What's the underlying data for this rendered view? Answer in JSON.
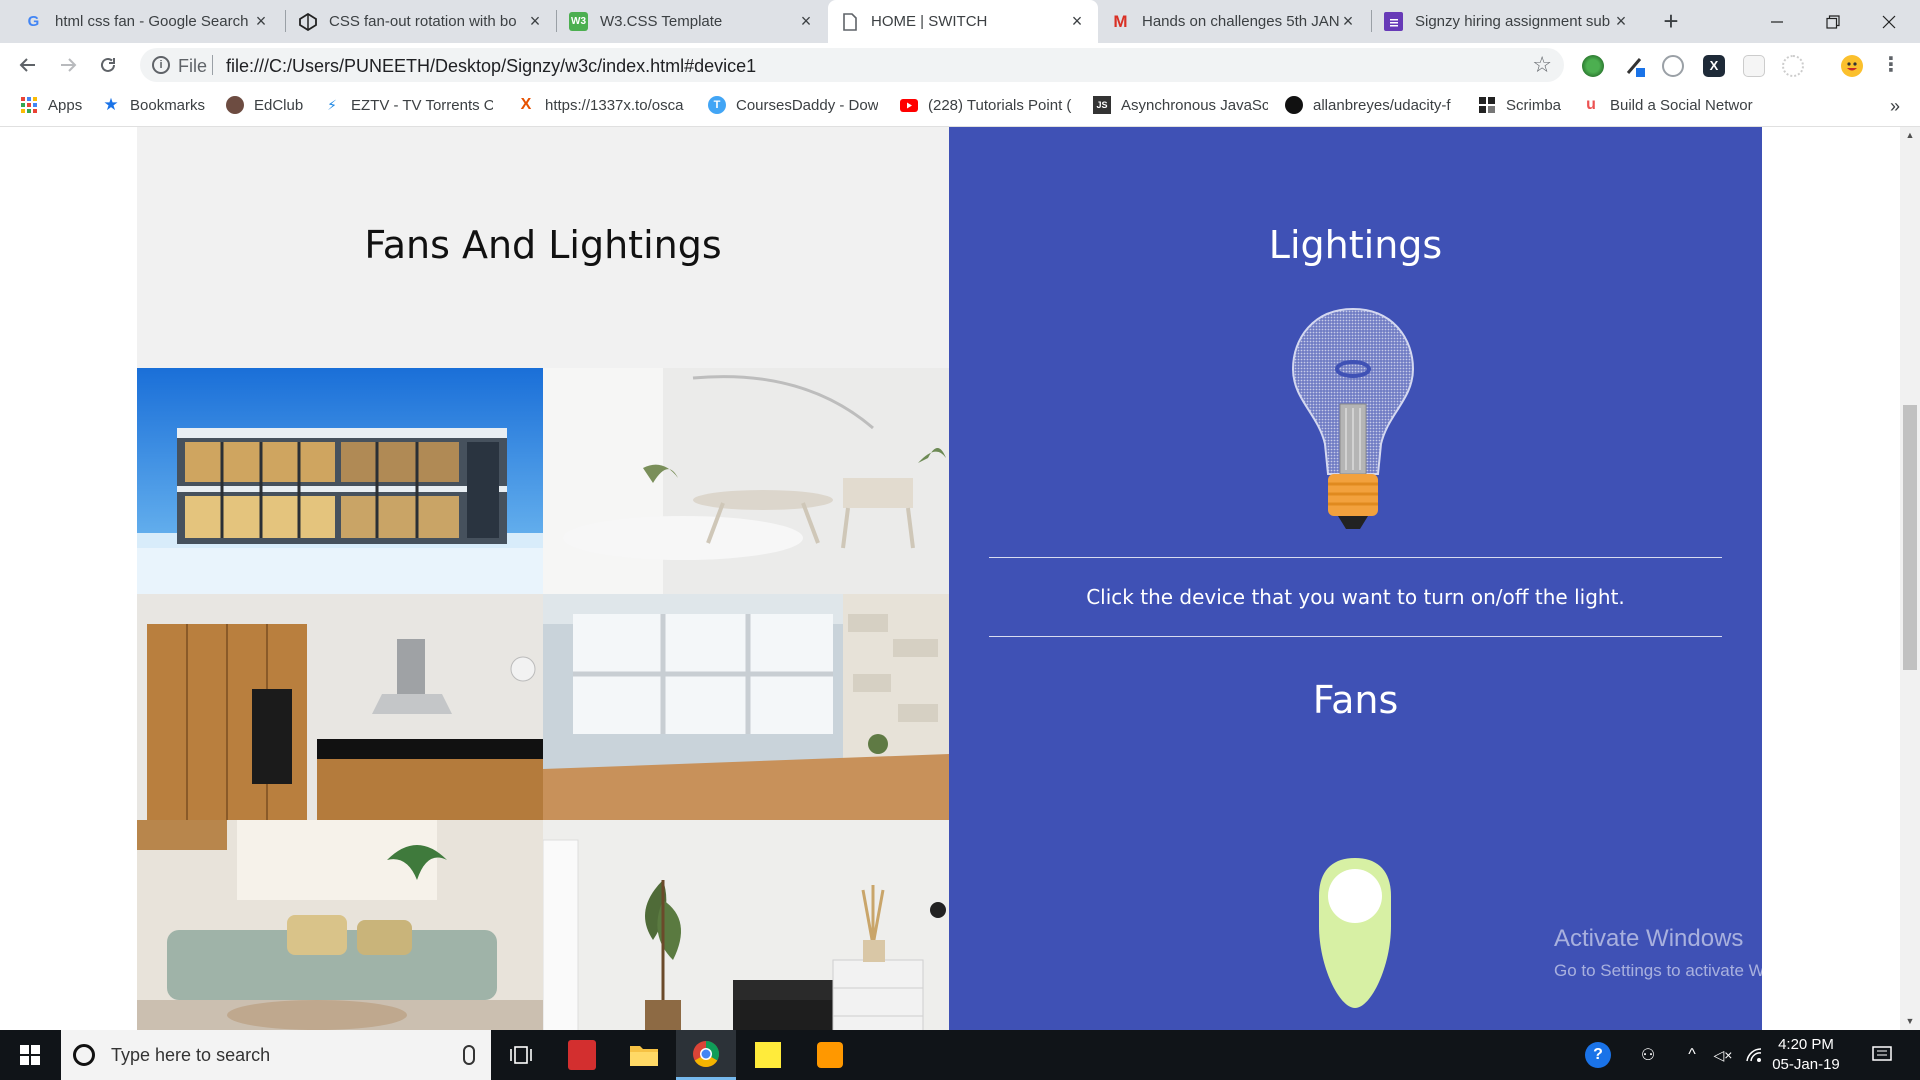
{
  "browser": {
    "tabs": [
      {
        "title": "html css fan - Google Search",
        "icon": "google-icon",
        "active": false
      },
      {
        "title": "CSS fan-out rotation with bo",
        "icon": "codepen-icon",
        "active": false
      },
      {
        "title": "W3.CSS Template",
        "icon": "w3-icon",
        "active": false
      },
      {
        "title": "HOME | SWITCH",
        "icon": "document-icon",
        "active": true
      },
      {
        "title": "Hands on challenges 5th JAN",
        "icon": "gmail-icon",
        "active": false
      },
      {
        "title": "Signzy hiring assignment sub",
        "icon": "forms-icon",
        "active": false
      }
    ],
    "omnibox": {
      "scheme_label": "File",
      "url": "file:///C:/Users/PUNEETH/Desktop/Signzy/w3c/index.html#device1"
    },
    "bookmarks": [
      {
        "label": "Apps",
        "icon": "apps-grid-icon"
      },
      {
        "label": "Bookmarks",
        "icon": "star-icon"
      },
      {
        "label": "EdClub",
        "icon": "edclub-icon"
      },
      {
        "label": "EZTV - TV Torrents O",
        "icon": "eztv-icon"
      },
      {
        "label": "https://1337x.to/osca",
        "icon": "x-icon"
      },
      {
        "label": "CoursesDaddy - Dow",
        "icon": "coursesdaddy-icon"
      },
      {
        "label": "(228) Tutorials Point (",
        "icon": "youtube-icon"
      },
      {
        "label": "Asynchronous JavaSc",
        "icon": "js-icon"
      },
      {
        "label": "allanbreyes/udacity-f",
        "icon": "github-icon"
      },
      {
        "label": "Scrimba",
        "icon": "scrimba-icon"
      },
      {
        "label": "Build a Social Networ",
        "icon": "udemy-icon"
      }
    ]
  },
  "page": {
    "left_title": "Fans And Lightings",
    "lightings_title": "Lightings",
    "instruction": "Click the device that you want to turn on/off the light.",
    "fans_title": "Fans",
    "watermark_title": "Activate Windows",
    "watermark_sub": "Go to Settings to activate Windows."
  },
  "taskbar": {
    "search_placeholder": "Type here to search",
    "time": "4:20 PM",
    "date": "05-Jan-19"
  },
  "colors": {
    "accent": "#3f51b5",
    "left_panel": "#f1f1f1",
    "fan_toggle": "#d7f0a4"
  }
}
